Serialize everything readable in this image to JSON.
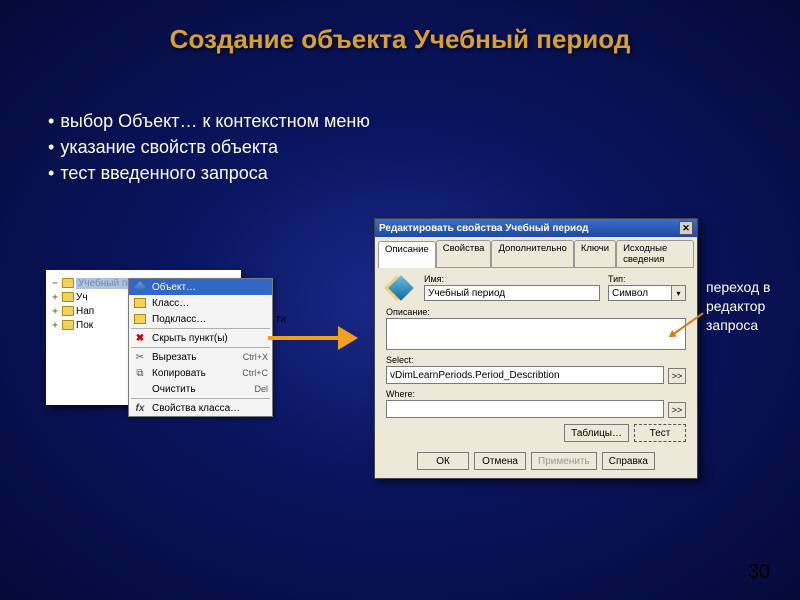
{
  "slide": {
    "title": "Создание объекта Учебный период",
    "bullets": [
      "выбор Объект… к контекстном меню",
      "указание свойств объекта",
      "тест введенного запроса"
    ],
    "annotation": "переход в редактор запроса",
    "page_number": "30"
  },
  "tree": {
    "rows": [
      {
        "twisty": "−",
        "label": "Учебный период",
        "sel": true,
        "faded": true
      },
      {
        "twisty": "+",
        "label": "Уч"
      },
      {
        "twisty": "+",
        "label": "Нап"
      },
      {
        "twisty": "+",
        "label": "Пок"
      }
    ],
    "truncated_suffix": "ти"
  },
  "context_menu": {
    "items": [
      {
        "icon": "cube",
        "label": "Объект…",
        "hl": true
      },
      {
        "icon": "folder",
        "label": "Класс…"
      },
      {
        "icon": "folder",
        "label": "Подкласс…"
      },
      {
        "sep": true
      },
      {
        "icon": "redx",
        "label": "Скрыть пункт(ы)"
      },
      {
        "sep": true
      },
      {
        "icon": "scissors",
        "label": "Вырезать",
        "shortcut": "Ctrl+X"
      },
      {
        "icon": "pages",
        "label": "Копировать",
        "shortcut": "Ctrl+C"
      },
      {
        "icon": "",
        "label": "Очистить",
        "shortcut": "Del"
      },
      {
        "sep": true
      },
      {
        "icon": "fx",
        "label": "Свойства класса…"
      }
    ]
  },
  "dialog": {
    "title": "Редактировать свойства Учебный период",
    "tabs": [
      "Описание",
      "Свойства",
      "Дополнительно",
      "Ключи",
      "Исходные сведения"
    ],
    "active_tab": 0,
    "name_label": "Имя:",
    "name_value": "Учебный период",
    "type_label": "Тип:",
    "type_value": "Символ",
    "desc_label": "Описание:",
    "select_label": "Select:",
    "select_value": "vDimLearnPeriods.Period_Describtion",
    "where_label": "Where:",
    "sq_btn": ">>",
    "inner_buttons": {
      "tables": "Таблицы…",
      "test": "Тест"
    },
    "footer": {
      "ok": "ОК",
      "cancel": "Отмена",
      "apply": "Применить",
      "help": "Справка"
    }
  }
}
